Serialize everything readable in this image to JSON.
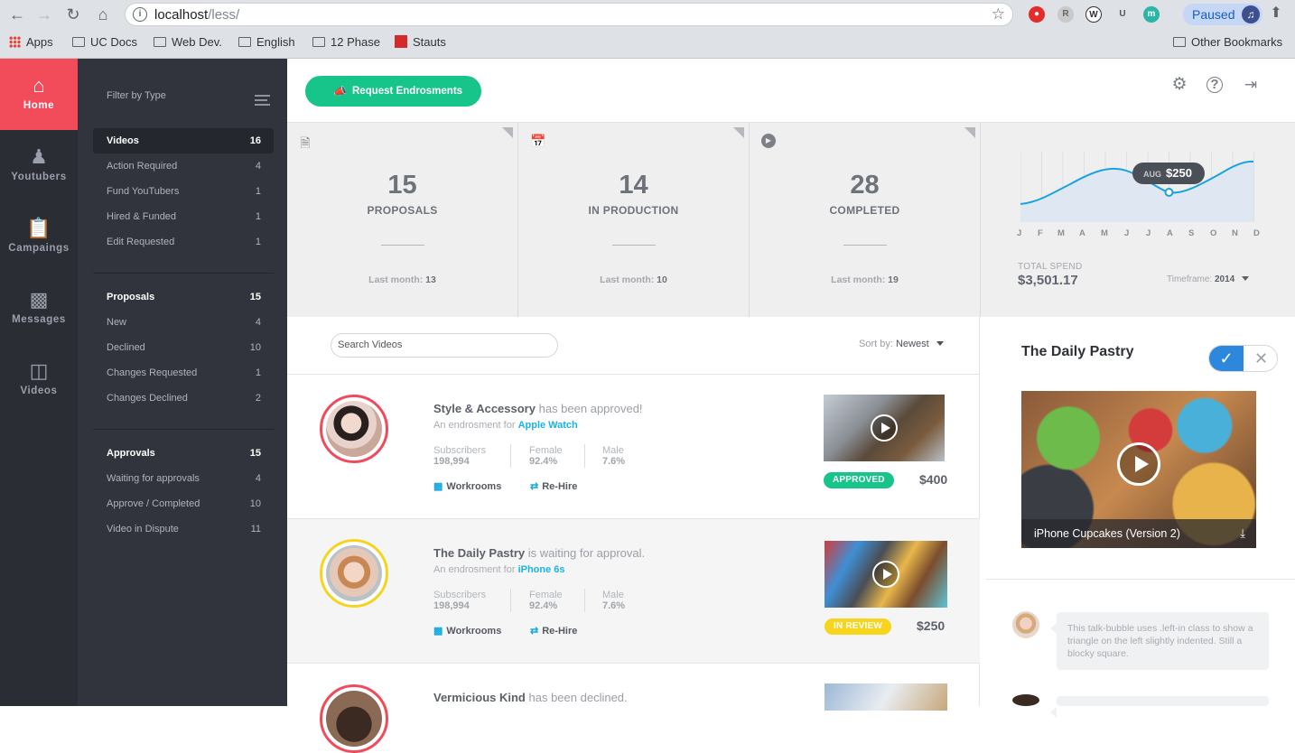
{
  "browser": {
    "url_host": "localhost",
    "url_path": "/less/",
    "paused_label": "Paused",
    "bookmarks": [
      {
        "label": "Apps",
        "icon": "apps-grid-icon"
      },
      {
        "label": "UC Docs",
        "icon": "folder-icon"
      },
      {
        "label": "Web Dev.",
        "icon": "folder-icon"
      },
      {
        "label": "English",
        "icon": "folder-icon"
      },
      {
        "label": "12 Phase",
        "icon": "folder-icon"
      },
      {
        "label": "Stauts",
        "icon": "site-icon"
      }
    ],
    "other_bookmarks": "Other Bookmarks"
  },
  "rail": [
    {
      "label": "Home",
      "icon": "home-icon",
      "active": true
    },
    {
      "label": "Youtubers",
      "icon": "user-icon"
    },
    {
      "label": "Campaings",
      "icon": "clipboard-icon"
    },
    {
      "label": "Messages",
      "icon": "chat-icon"
    },
    {
      "label": "Videos",
      "icon": "tv-icon"
    }
  ],
  "filter": {
    "title": "Filter by Type",
    "groups": [
      {
        "label": "Videos",
        "count": "16",
        "items": [
          {
            "label": "Action Required",
            "count": "4"
          },
          {
            "label": "Fund YouTubers",
            "count": "1"
          },
          {
            "label": "Hired & Funded",
            "count": "1"
          },
          {
            "label": "Edit Requested",
            "count": "1"
          }
        ]
      },
      {
        "label": "Proposals",
        "count": "15",
        "items": [
          {
            "label": "New",
            "count": "4"
          },
          {
            "label": "Declined",
            "count": "10"
          },
          {
            "label": "Changes Requested",
            "count": "1"
          },
          {
            "label": "Changes Declined",
            "count": "2"
          }
        ]
      },
      {
        "label": "Approvals",
        "count": "15",
        "items": [
          {
            "label": "Waiting for approvals",
            "count": "4"
          },
          {
            "label": "Approve / Completed",
            "count": "10"
          },
          {
            "label": "Video in Dispute",
            "count": "11"
          }
        ]
      }
    ]
  },
  "topbar": {
    "request_button": "Request Endrosments",
    "icons": [
      "gear-icon",
      "help-icon",
      "logout-icon"
    ]
  },
  "stats": [
    {
      "icon": "document-icon",
      "value": "15",
      "label": "PROPOSALS",
      "last_label": "Last month:",
      "last_value": "13"
    },
    {
      "icon": "calendar-icon",
      "value": "14",
      "label": "IN PRODUCTION",
      "last_label": "Last month:",
      "last_value": "10"
    },
    {
      "icon": "play-circle-icon",
      "value": "28",
      "label": "COMPLETED",
      "last_label": "Last month:",
      "last_value": "19"
    }
  ],
  "spend": {
    "total_label": "TOTAL SPEND",
    "total_value": "$3,501.17",
    "timeframe_label": "Timeframe:",
    "timeframe_value": "2014",
    "tooltip_month": "AUG",
    "tooltip_value": "$250",
    "accent": "#1aa3e0"
  },
  "chart_data": {
    "type": "area",
    "categories": [
      "J",
      "F",
      "M",
      "A",
      "M",
      "J",
      "J",
      "A",
      "S",
      "O",
      "N",
      "D"
    ],
    "highlight": {
      "category_index": 7,
      "label": "AUG",
      "value": "$250"
    }
  },
  "list": {
    "search_placeholder": "Search Videos",
    "sort_label": "Sort by:",
    "sort_value": "Newest",
    "rows": [
      {
        "name": "Style & Accessory",
        "status_text": "has been approved!",
        "sub_prefix": "An endrosment for",
        "product": "Apple Watch",
        "subscribers_label": "Subscribers",
        "subscribers": "198,994",
        "female_label": "Female",
        "female": "92.4%",
        "male_label": "Male",
        "male": "7.6%",
        "workrooms": "Workrooms",
        "rehire": "Re-Hire",
        "badge": "APPROVED",
        "price": "$400"
      },
      {
        "name": "The Daily Pastry",
        "status_text": "is waiting for approval.",
        "sub_prefix": "An endrosment for",
        "product": "iPhone 6s",
        "subscribers_label": "Subscribers",
        "subscribers": "198,994",
        "female_label": "Female",
        "female": "92.4%",
        "male_label": "Male",
        "male": "7.6%",
        "workrooms": "Workrooms",
        "rehire": "Re-Hire",
        "badge": "IN REVIEW",
        "price": "$250"
      },
      {
        "name": "Vermicious Kind",
        "status_text": "has been declined."
      }
    ]
  },
  "detail": {
    "title": "The Daily Pastry",
    "video_caption": "iPhone Cupcakes (Version 2)",
    "message": "This talk-bubble uses .left-in class to show a triangle on the left slightly indented. Still a blocky square."
  },
  "colors": {
    "home_active": "#f24b5a",
    "approved": "#17c48a",
    "in_review": "#f7d51c",
    "link": "#19b4e4",
    "confirm": "#2d88dd"
  }
}
